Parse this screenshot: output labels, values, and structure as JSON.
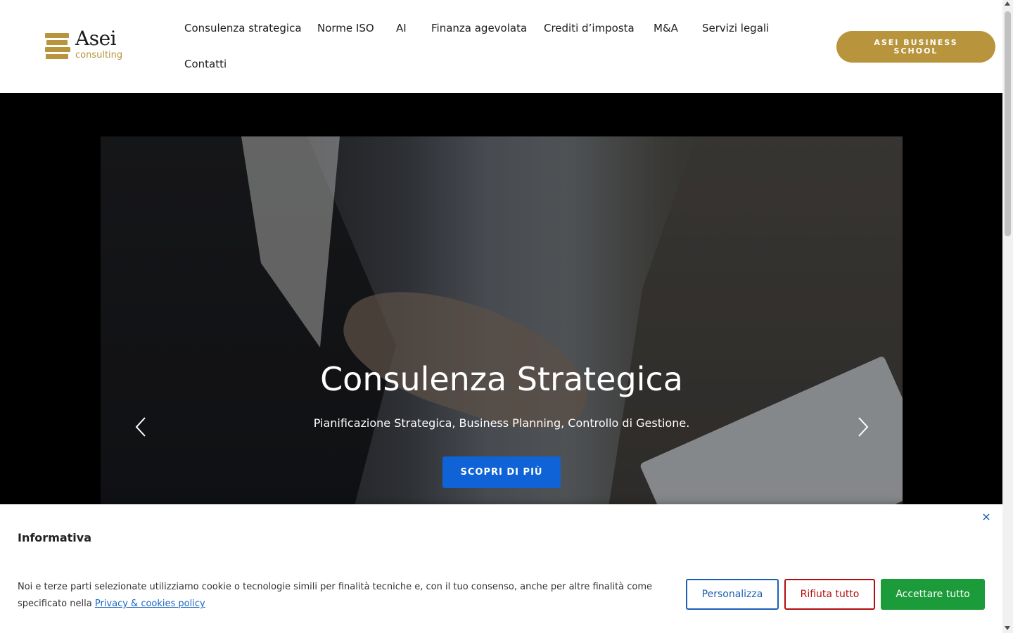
{
  "header": {
    "logo": {
      "name": "Asei",
      "sub": "consulting"
    },
    "nav": [
      {
        "label": "Consulenza strategica"
      },
      {
        "label": "Norme ISO"
      },
      {
        "label": "AI"
      },
      {
        "label": "Finanza agevolata"
      },
      {
        "label": "Crediti d’imposta"
      },
      {
        "label": "M&A"
      },
      {
        "label": "Servizi legali"
      },
      {
        "label": "Contatti"
      }
    ],
    "cta_label": "ASEI BUSINESS SCHOOL"
  },
  "hero": {
    "title": "Consulenza Strategica",
    "subtitle": "Pianificazione Strategica, Business Planning, Controllo di Gestione.",
    "button_label": "SCOPRI DI PIÙ"
  },
  "cookie": {
    "title": "Informativa",
    "text_before": "Noi e terze parti selezionate utilizziamo cookie o tecnologie simili per finalità tecniche e, con il tuo consenso, anche per altre finalità come specificato nella",
    "link_label": "Privacy & cookies policy",
    "customize_label": "Personalizza",
    "reject_label": "Rifiuta tutto",
    "accept_label": "Accettare tutto"
  },
  "colors": {
    "brand_gold": "#b8953d",
    "primary_blue": "#0f63d6",
    "accept_green": "#1c9b3a",
    "reject_red": "#b40d0d"
  }
}
